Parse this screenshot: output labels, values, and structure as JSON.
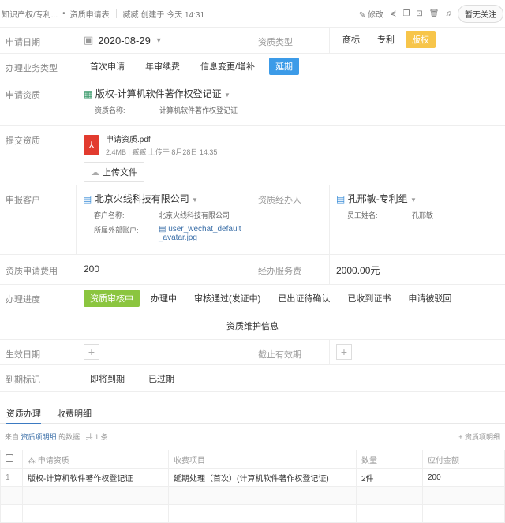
{
  "header": {
    "breadcrumb": "知识产权/专利...",
    "form": "资质申请表",
    "creator": "臧臧",
    "created": "创建于",
    "time": "今天 14:31",
    "edit": "修改",
    "follow": "暂无关注"
  },
  "fields": {
    "date_label": "申请日期",
    "date_value": "2020-08-29",
    "type_label": "资质类型",
    "type_options": [
      "商标",
      "专利",
      "版权"
    ],
    "biz_label": "办理业务类型",
    "biz_options": [
      "首次申请",
      "年审续费",
      "信息变更/增补",
      "延期"
    ],
    "qual_label": "申请资质",
    "qual_value": "版权-计算机软件著作权登记证",
    "qual_name_key": "资质名称:",
    "qual_name_val": "计算机软件著作权登记证",
    "submit_label": "提交资质",
    "file_name": "申请资质.pdf",
    "file_meta": "2.4MB | 臧臧 上传于 8月28日 14:35",
    "upload": "上传文件",
    "client_label": "申报客户",
    "client_value": "北京火线科技有限公司",
    "client_name_key": "客户名称:",
    "client_name_val": "北京火线科技有限公司",
    "account_key": "所属外部账户:",
    "account_val": "user_wechat_default_avatar.jpg",
    "agent_label": "资质经办人",
    "agent_value": "孔邢敏-专利组",
    "staff_key": "员工姓名:",
    "staff_val": "孔邢敏",
    "fee_label": "资质申请费用",
    "fee_value": "200",
    "service_label": "经办服务费",
    "service_value": "2000.00元",
    "progress_label": "办理进度",
    "progress_options": [
      "资质审核中",
      "办理中",
      "审核通过(发证中)",
      "已出证待确认",
      "已收到证书",
      "申请被驳回"
    ],
    "section": "资质维护信息",
    "effective_label": "生效日期",
    "expiry_label": "截止有效期",
    "mark_label": "到期标记",
    "mark_options": [
      "即将到期",
      "已过期"
    ]
  },
  "tabs": [
    "资质办理",
    "收费明细"
  ],
  "info": {
    "from": "来自",
    "src": "资质项明细",
    "suffix": "的数据",
    "count": "共 1 条",
    "add": "+ 资质项明细"
  },
  "table": {
    "headers": [
      "申请资质",
      "收费项目",
      "数量",
      "应付金额"
    ],
    "rows": [
      {
        "n": "1",
        "qual": "版权-计算机软件著作权登记证",
        "item": "延期处理（首次）(计算机软件著作权登记证)",
        "qty": "2件",
        "amt": "200"
      }
    ]
  }
}
